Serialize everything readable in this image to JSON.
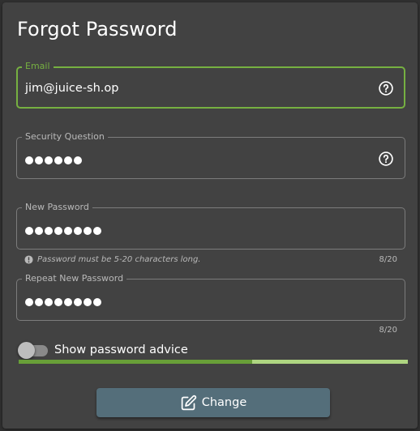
{
  "page": {
    "title": "Forgot Password"
  },
  "form": {
    "email": {
      "label": "Email",
      "value": "jim@juice-sh.op",
      "icon": "help-circle-icon"
    },
    "security_question": {
      "label": "Security Question",
      "masked_length": 6,
      "icon": "help-circle-icon"
    },
    "new_password": {
      "label": "New Password",
      "masked_length": 8,
      "hint": "Password must be 5-20 characters long.",
      "counter": "8/20"
    },
    "repeat_password": {
      "label": "Repeat New Password",
      "masked_length": 8,
      "counter": "8/20"
    },
    "advice_toggle": {
      "label": "Show password advice",
      "checked": false
    },
    "strength": {
      "fraction": 0.6
    },
    "submit": {
      "label": "Change",
      "icon": "edit-icon"
    }
  },
  "colors": {
    "accent": "#76b041",
    "strength_filled": "#689f38",
    "strength_empty": "#aed581",
    "button": "#546e7a"
  }
}
